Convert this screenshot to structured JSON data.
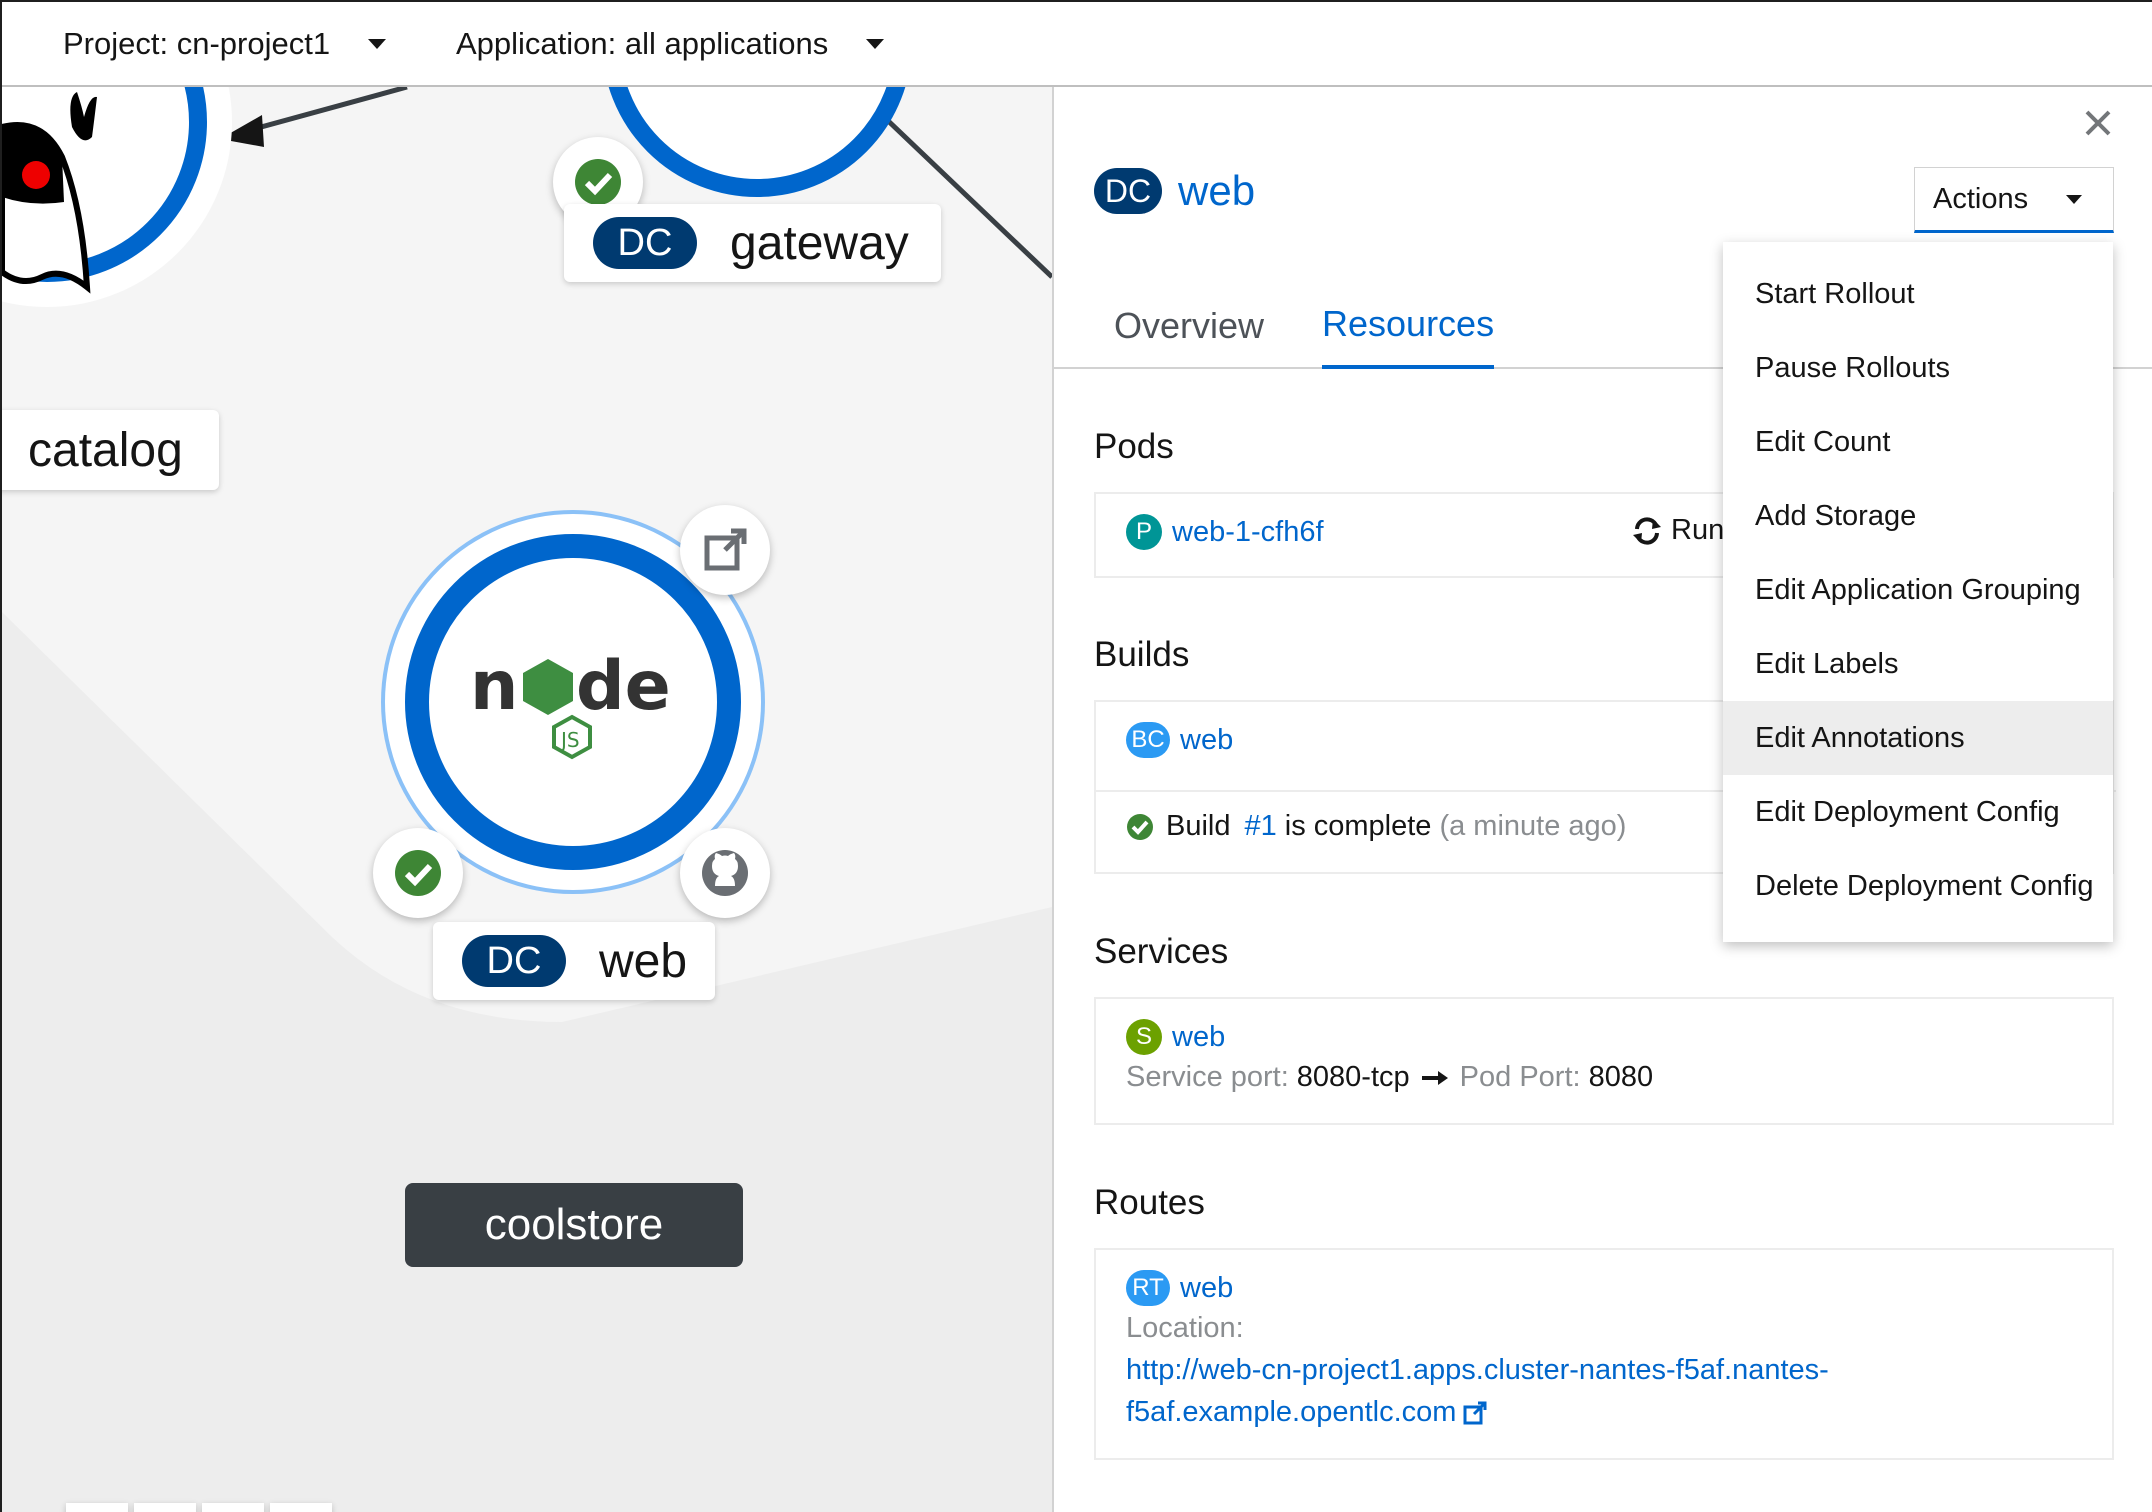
{
  "topbar": {
    "project_label": "Project: cn-project1",
    "application_label": "Application: all applications"
  },
  "topology": {
    "nodes": [
      {
        "name": "catalog",
        "kind": "",
        "status": "ok"
      },
      {
        "name": "gateway",
        "kind": "DC",
        "status": "ok"
      },
      {
        "name": "web",
        "kind": "DC",
        "status": "ok"
      }
    ],
    "group_label": "coolstore",
    "controls": [
      "zoom-in",
      "zoom-out",
      "fit-to-screen",
      "expand"
    ]
  },
  "panel": {
    "kind_badge": "DC",
    "title": "web",
    "actions_label": "Actions",
    "tabs": [
      {
        "label": "Overview",
        "active": false
      },
      {
        "label": "Resources",
        "active": true
      }
    ],
    "pods": {
      "title": "Pods",
      "badge": "P",
      "name": "web-1-cfh6f",
      "status": "Run"
    },
    "builds": {
      "title": "Builds",
      "badge": "BC",
      "name": "web",
      "status_prefix": "Build",
      "build_number": "#1",
      "status_suffix": "is complete",
      "time": "(a minute ago)"
    },
    "services": {
      "title": "Services",
      "badge": "S",
      "name": "web",
      "service_port_label": "Service port:",
      "service_port": "8080-tcp",
      "pod_port_label": "Pod Port:",
      "pod_port": "8080"
    },
    "routes": {
      "title": "Routes",
      "badge": "RT",
      "name": "web",
      "location_label": "Location:",
      "url_line1": "http://web-cn-project1.apps.cluster-nantes-f5af.nantes-",
      "url_line2": "f5af.example.opentlc.com"
    }
  },
  "actions_menu": {
    "items": [
      {
        "label": "Start Rollout",
        "hovered": false
      },
      {
        "label": "Pause Rollouts",
        "hovered": false
      },
      {
        "label": "Edit Count",
        "hovered": false
      },
      {
        "label": "Add Storage",
        "hovered": false
      },
      {
        "label": "Edit Application Grouping",
        "hovered": false
      },
      {
        "label": "Edit Labels",
        "hovered": false
      },
      {
        "label": "Edit Annotations",
        "hovered": true
      },
      {
        "label": "Edit Deployment Config",
        "hovered": false
      },
      {
        "label": "Delete Deployment Config",
        "hovered": false
      }
    ]
  },
  "colors": {
    "accent_blue": "#0066cc",
    "dc_badge": "#003a70",
    "success_green": "#3e8635",
    "group_label_bg": "#393f44",
    "pod_badge": "#009596",
    "bc_badge": "#2b9af3",
    "service_badge": "#6ca100",
    "route_badge": "#2b9af3"
  }
}
